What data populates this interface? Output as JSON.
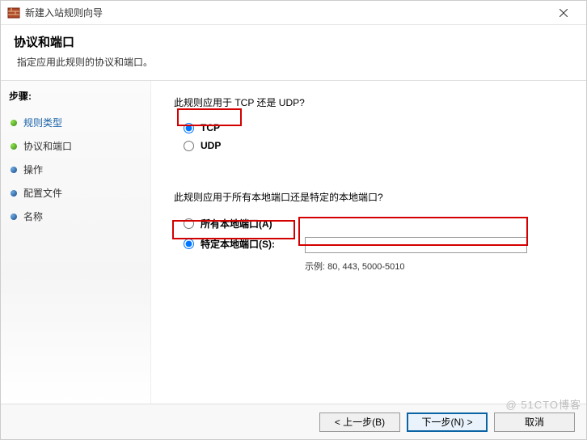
{
  "titlebar": {
    "text": "新建入站规则向导"
  },
  "header": {
    "title": "协议和端口",
    "desc": "指定应用此规则的协议和端口。"
  },
  "sidebar": {
    "title": "步骤:",
    "items": [
      {
        "label": "规则类型",
        "bullet": "green",
        "active": true
      },
      {
        "label": "协议和端口",
        "bullet": "green",
        "active": false
      },
      {
        "label": "操作",
        "bullet": "blue",
        "active": false
      },
      {
        "label": "配置文件",
        "bullet": "blue",
        "active": false
      },
      {
        "label": "名称",
        "bullet": "blue",
        "active": false
      }
    ]
  },
  "content": {
    "q1": "此规则应用于 TCP 还是 UDP?",
    "opt_tcp": "TCP",
    "opt_udp": "UDP",
    "q2": "此规则应用于所有本地端口还是特定的本地端口?",
    "opt_all_ports": "所有本地端口(A)",
    "opt_specific_ports": "特定本地端口(S):",
    "port_example": "示例: 80, 443, 5000-5010",
    "port_value": ""
  },
  "footer": {
    "back": "< 上一步(B)",
    "next": "下一步(N) >",
    "cancel": "取消"
  },
  "watermark": "@ 51CTO博客"
}
